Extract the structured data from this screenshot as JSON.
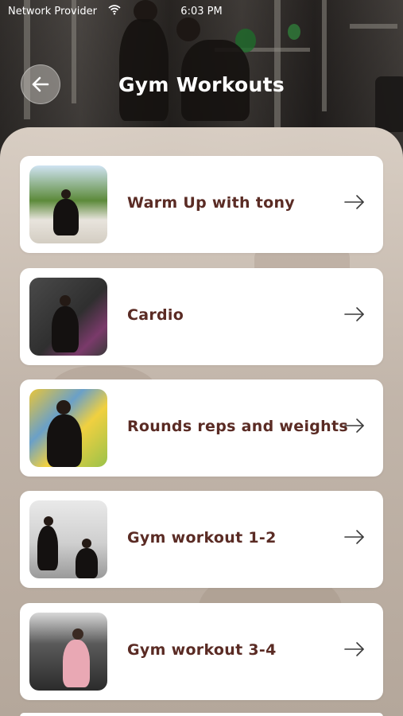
{
  "status_bar": {
    "carrier": "Network Provider",
    "time": "6:03 PM"
  },
  "header": {
    "title": "Gym Workouts",
    "back_icon": "arrow-left-icon"
  },
  "workouts": [
    {
      "title": "Warm Up with tony",
      "icon": "arrow-right-icon"
    },
    {
      "title": "Cardio",
      "icon": "arrow-right-icon"
    },
    {
      "title": "Rounds reps and weights",
      "icon": "arrow-right-icon"
    },
    {
      "title": "Gym workout 1-2",
      "icon": "arrow-right-icon"
    },
    {
      "title": "Gym workout 3-4",
      "icon": "arrow-right-icon"
    }
  ],
  "colors": {
    "title_text": "#5a2b24",
    "card_bg": "#ffffff",
    "sheet_bg": "#d8cbbf",
    "header_text": "#ffffff"
  }
}
